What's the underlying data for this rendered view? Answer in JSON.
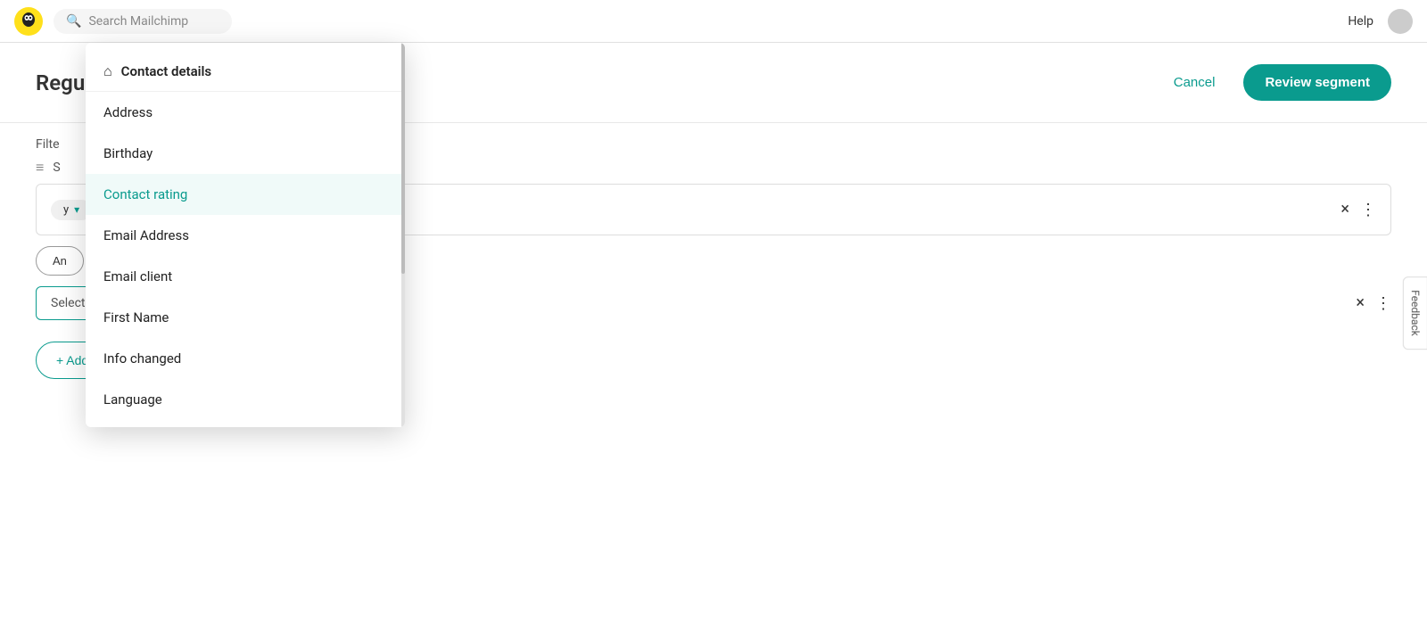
{
  "navbar": {
    "search_placeholder": "Search Mailchimp",
    "help_label": "Help"
  },
  "modal": {
    "title": "Regu",
    "cancel_label": "Cancel",
    "review_label": "Review segment"
  },
  "filter_section": {
    "label": "Filte"
  },
  "segment_label": "S",
  "dropdown": {
    "header": "Contact details",
    "items": [
      {
        "label": "Address",
        "active": false
      },
      {
        "label": "Birthday",
        "active": false
      },
      {
        "label": "Contact rating",
        "active": true
      },
      {
        "label": "Email Address",
        "active": false
      },
      {
        "label": "Email client",
        "active": false
      },
      {
        "label": "First Name",
        "active": false
      },
      {
        "label": "Info changed",
        "active": false
      },
      {
        "label": "Language",
        "active": false
      }
    ]
  },
  "filter_tag": {
    "label": "y",
    "chevron": "▾"
  },
  "and_button": "An",
  "select_filter_placeholder": "Select or search a filter",
  "add_filter_label": "+ Add filter",
  "feedback_label": "Feedback"
}
